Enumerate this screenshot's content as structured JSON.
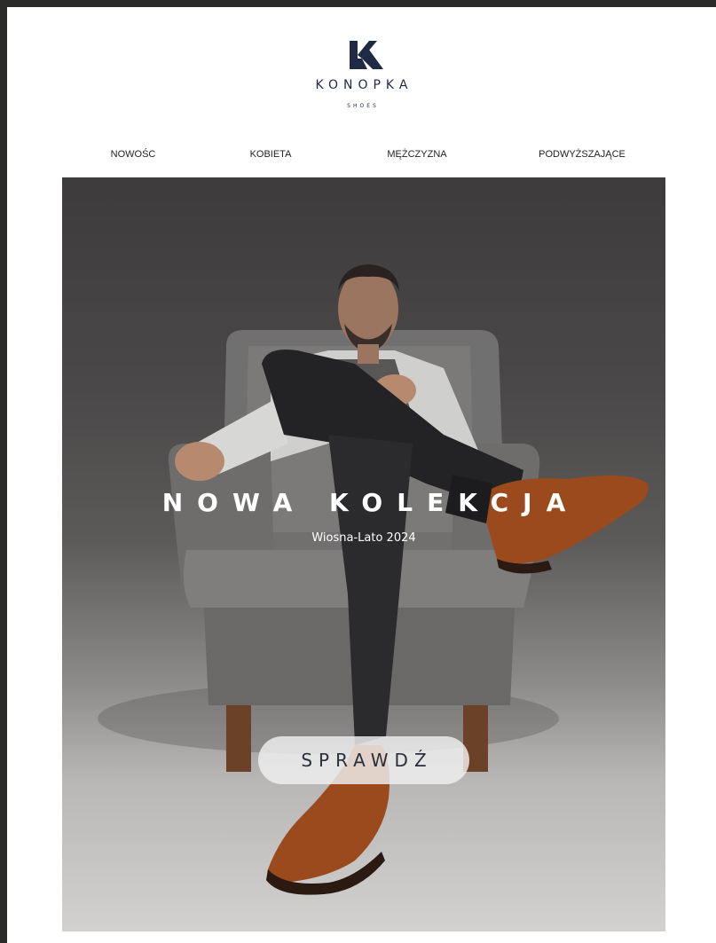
{
  "brand": {
    "logo_icon": "konopka-k-logo-icon",
    "name": "KONOPKA",
    "sub": "SHOES",
    "color": "#1f2a44"
  },
  "nav": {
    "items": [
      {
        "label": "NOWOŚC"
      },
      {
        "label": "KOBIETA"
      },
      {
        "label": "MĘŻCZYZNA"
      },
      {
        "label": "PODWYŻSZAJĄCE"
      }
    ]
  },
  "hero": {
    "title": "NOWA KOLEKCJA",
    "subtitle": "Wiosna-Lato 2024",
    "cta_label": "SPRAWDŹ",
    "image": "man-in-armchair-wearing-brown-brogue-shoes"
  }
}
